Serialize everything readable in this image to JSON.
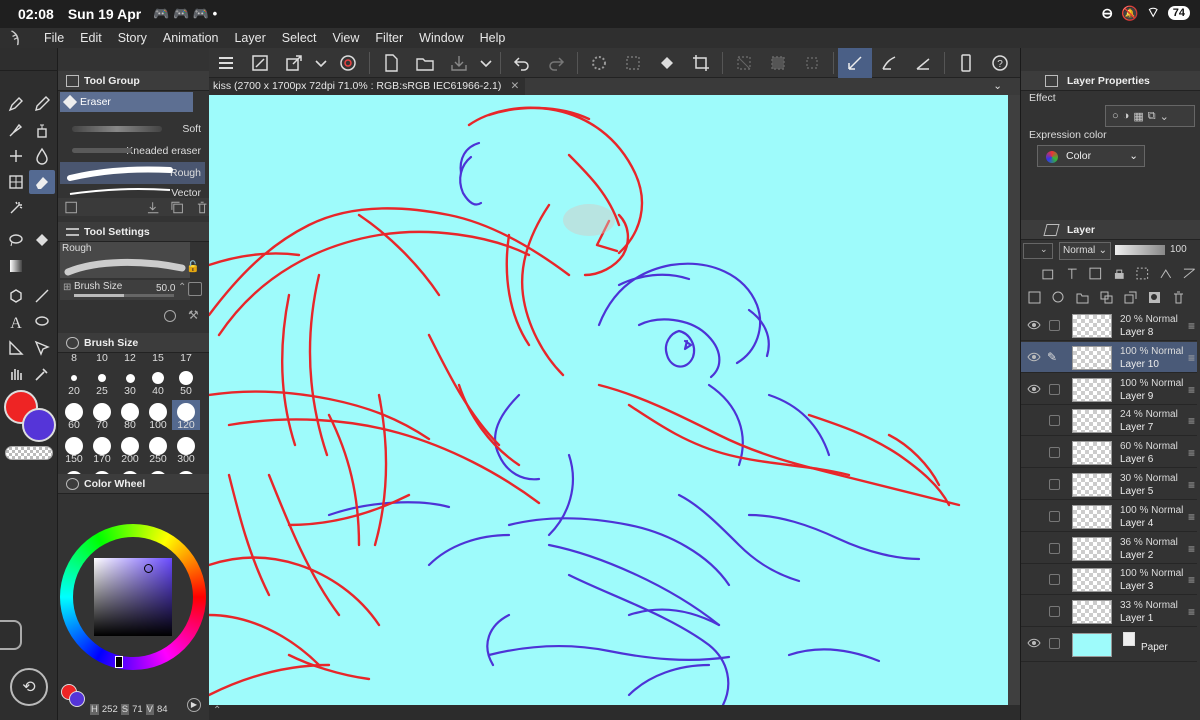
{
  "status_bar": {
    "time": "02:08",
    "date": "Sun 19 Apr",
    "battery": "74"
  },
  "menu": [
    "File",
    "Edit",
    "Story",
    "Animation",
    "Layer",
    "Select",
    "View",
    "Filter",
    "Window",
    "Help"
  ],
  "tool_group": {
    "title": "Tool Group",
    "selected_tool": "Eraser",
    "brushes": [
      "Soft",
      "Kneaded eraser",
      "Rough",
      "Vector"
    ]
  },
  "tool_settings": {
    "title": "Tool Settings",
    "preset": "Rough",
    "brush_size_label": "Brush Size",
    "brush_size_value": "50.0"
  },
  "brush_size_panel": {
    "title": "Brush Size",
    "sizes": [
      "8",
      "10",
      "12",
      "15",
      "17",
      "20",
      "25",
      "30",
      "40",
      "50",
      "60",
      "70",
      "80",
      "100",
      "120",
      "150",
      "170",
      "200",
      "250",
      "300"
    ],
    "selected": "50"
  },
  "color_wheel": {
    "title": "Color Wheel",
    "h": "252",
    "s": "71",
    "v": "84",
    "h_label": "H",
    "s_label": "S",
    "v_label": "V",
    "main_color": "#ee2424",
    "sub_color": "#5535d8"
  },
  "document_tab": {
    "title": "kiss (2700 x 1700px 72dpi 71.0% : RGB:sRGB IEC61966-2.1)"
  },
  "canvas": {
    "background": "#9efbfb",
    "stroke_red": "#e8262a",
    "stroke_blue": "#4d33d6"
  },
  "layer_properties": {
    "title": "Layer Properties",
    "effect_label": "Effect",
    "expression_label": "Expression color",
    "expression_value": "Color"
  },
  "layer_panel": {
    "title": "Layer",
    "blend_mode": "Normal",
    "opacity": "100",
    "layers": [
      {
        "percent": "20 %",
        "mode": "Normal",
        "name": "Layer 8",
        "visible": true,
        "selected": false
      },
      {
        "percent": "100 %",
        "mode": "Normal",
        "name": "Layer 10",
        "visible": true,
        "selected": true
      },
      {
        "percent": "100 %",
        "mode": "Normal",
        "name": "Layer 9",
        "visible": true,
        "selected": false
      },
      {
        "percent": "24 %",
        "mode": "Normal",
        "name": "Layer 7",
        "visible": false,
        "selected": false
      },
      {
        "percent": "60 %",
        "mode": "Normal",
        "name": "Layer 6",
        "visible": false,
        "selected": false
      },
      {
        "percent": "30 %",
        "mode": "Normal",
        "name": "Layer 5",
        "visible": false,
        "selected": false
      },
      {
        "percent": "100 %",
        "mode": "Normal",
        "name": "Layer 4",
        "visible": false,
        "selected": false
      },
      {
        "percent": "36 %",
        "mode": "Normal",
        "name": "Layer 2",
        "visible": false,
        "selected": false
      },
      {
        "percent": "100 %",
        "mode": "Normal",
        "name": "Layer 3",
        "visible": false,
        "selected": false
      },
      {
        "percent": "33 %",
        "mode": "Normal",
        "name": "Layer 1",
        "visible": false,
        "selected": false
      }
    ],
    "paper": {
      "name": "Paper",
      "color": "#9efbfb"
    }
  }
}
